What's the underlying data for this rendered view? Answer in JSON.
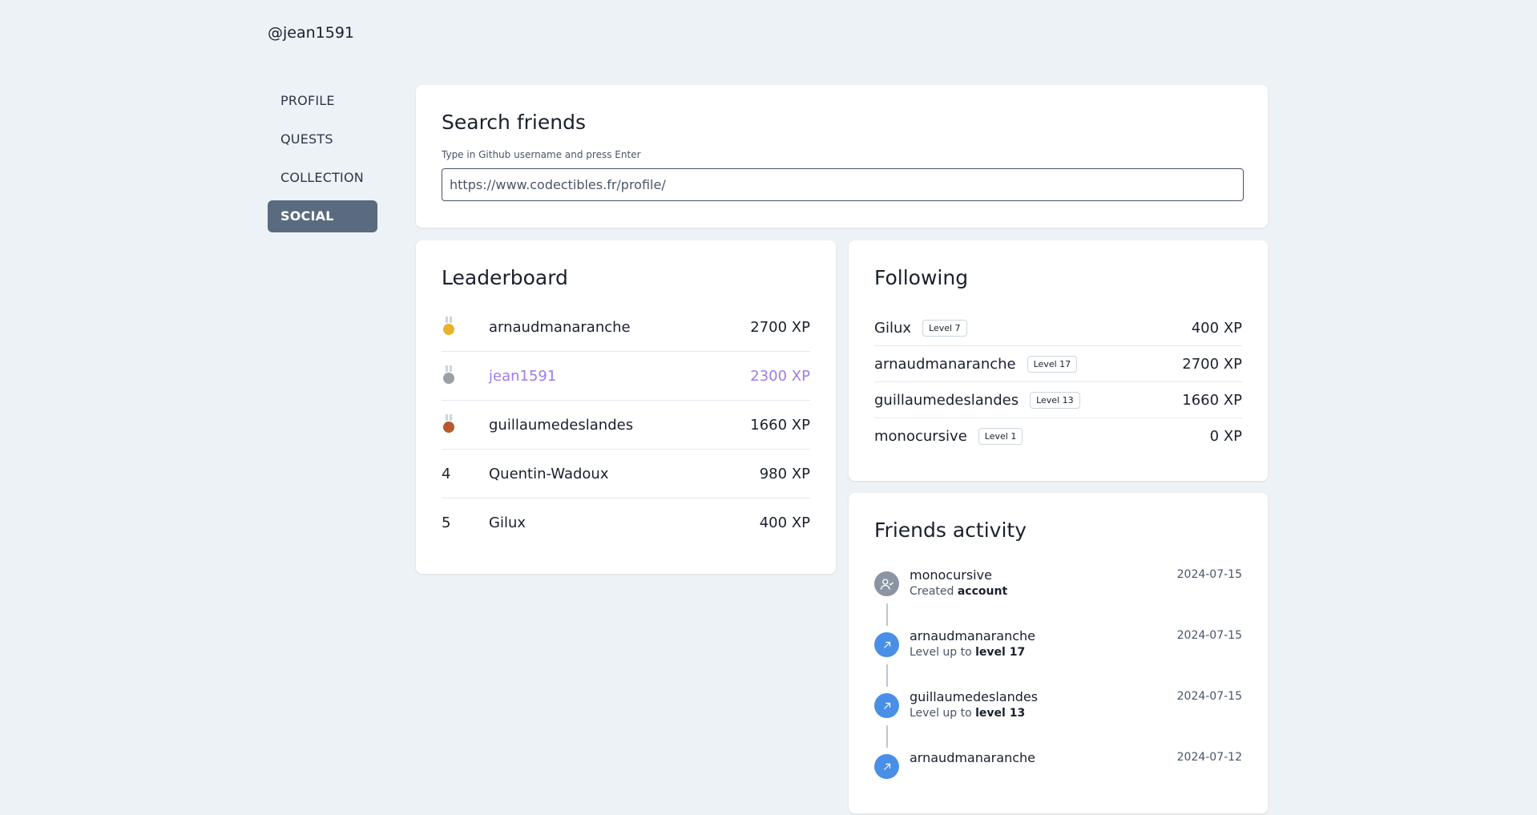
{
  "header": {
    "username": "@jean1591"
  },
  "sidebar": {
    "items": [
      {
        "label": "PROFILE"
      },
      {
        "label": "QUESTS"
      },
      {
        "label": "COLLECTION"
      },
      {
        "label": "SOCIAL"
      }
    ],
    "active": "SOCIAL"
  },
  "search": {
    "title": "Search friends",
    "hint": "Type in Github username and press Enter",
    "value": "https://www.codectibles.fr/profile/"
  },
  "leaderboard": {
    "title": "Leaderboard",
    "rows": [
      {
        "rank": "",
        "medal": "gold",
        "name": "arnaudmanaranche",
        "xp": "2700 XP"
      },
      {
        "rank": "",
        "medal": "silver",
        "name": "jean1591",
        "xp": "2300 XP"
      },
      {
        "rank": "",
        "medal": "bronze",
        "name": "guillaumedeslandes",
        "xp": "1660 XP"
      },
      {
        "rank": "4",
        "name": "Quentin-Wadoux",
        "xp": "980 XP"
      },
      {
        "rank": "5",
        "name": "Gilux",
        "xp": "400 XP"
      }
    ]
  },
  "following": {
    "title": "Following",
    "rows": [
      {
        "name": "Gilux",
        "level": "Level 7",
        "xp": "400 XP"
      },
      {
        "name": "arnaudmanaranche",
        "level": "Level 17",
        "xp": "2700 XP"
      },
      {
        "name": "guillaumedeslandes",
        "level": "Level 13",
        "xp": "1660 XP"
      },
      {
        "name": "monocursive",
        "level": "Level 1",
        "xp": "0 XP"
      }
    ]
  },
  "activity": {
    "title": "Friends activity",
    "items": [
      {
        "icon": "user-check-icon",
        "user": "monocursive",
        "text": "Created",
        "highlight": "account",
        "date": "2024-07-15"
      },
      {
        "icon": "arrow-up-right-icon",
        "user": "arnaudmanaranche",
        "text": "Level up to",
        "highlight": "level 17",
        "date": "2024-07-15"
      },
      {
        "icon": "arrow-up-right-icon",
        "user": "guillaumedeslandes",
        "text": "Level up to",
        "highlight": "level 13",
        "date": "2024-07-15"
      },
      {
        "icon": "arrow-up-right-icon",
        "user": "arnaudmanaranche",
        "text": "",
        "highlight": "",
        "date": "2024-07-12"
      }
    ]
  }
}
